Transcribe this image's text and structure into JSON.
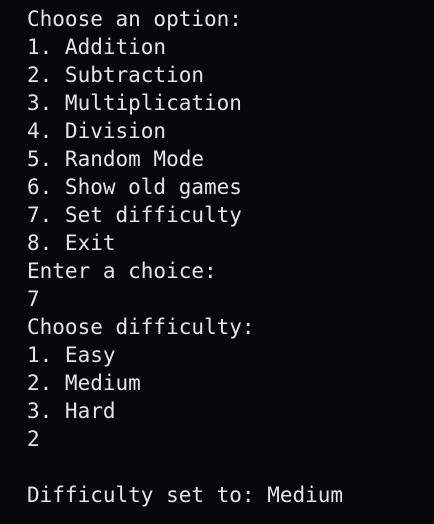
{
  "terminal": {
    "menu_prompt": "Choose an option:",
    "menu_options": [
      "1. Addition",
      "2. Subtraction",
      "3. Multiplication",
      "4. Division",
      "5. Random Mode",
      "6. Show old games",
      "7. Set difficulty",
      "8. Exit"
    ],
    "choice_prompt": "Enter a choice:",
    "choice_input": "7",
    "difficulty_prompt": "Choose difficulty:",
    "difficulty_options": [
      "1. Easy",
      "2. Medium",
      "3. Hard"
    ],
    "difficulty_input": "2",
    "result_message": "Difficulty set to: Medium"
  }
}
